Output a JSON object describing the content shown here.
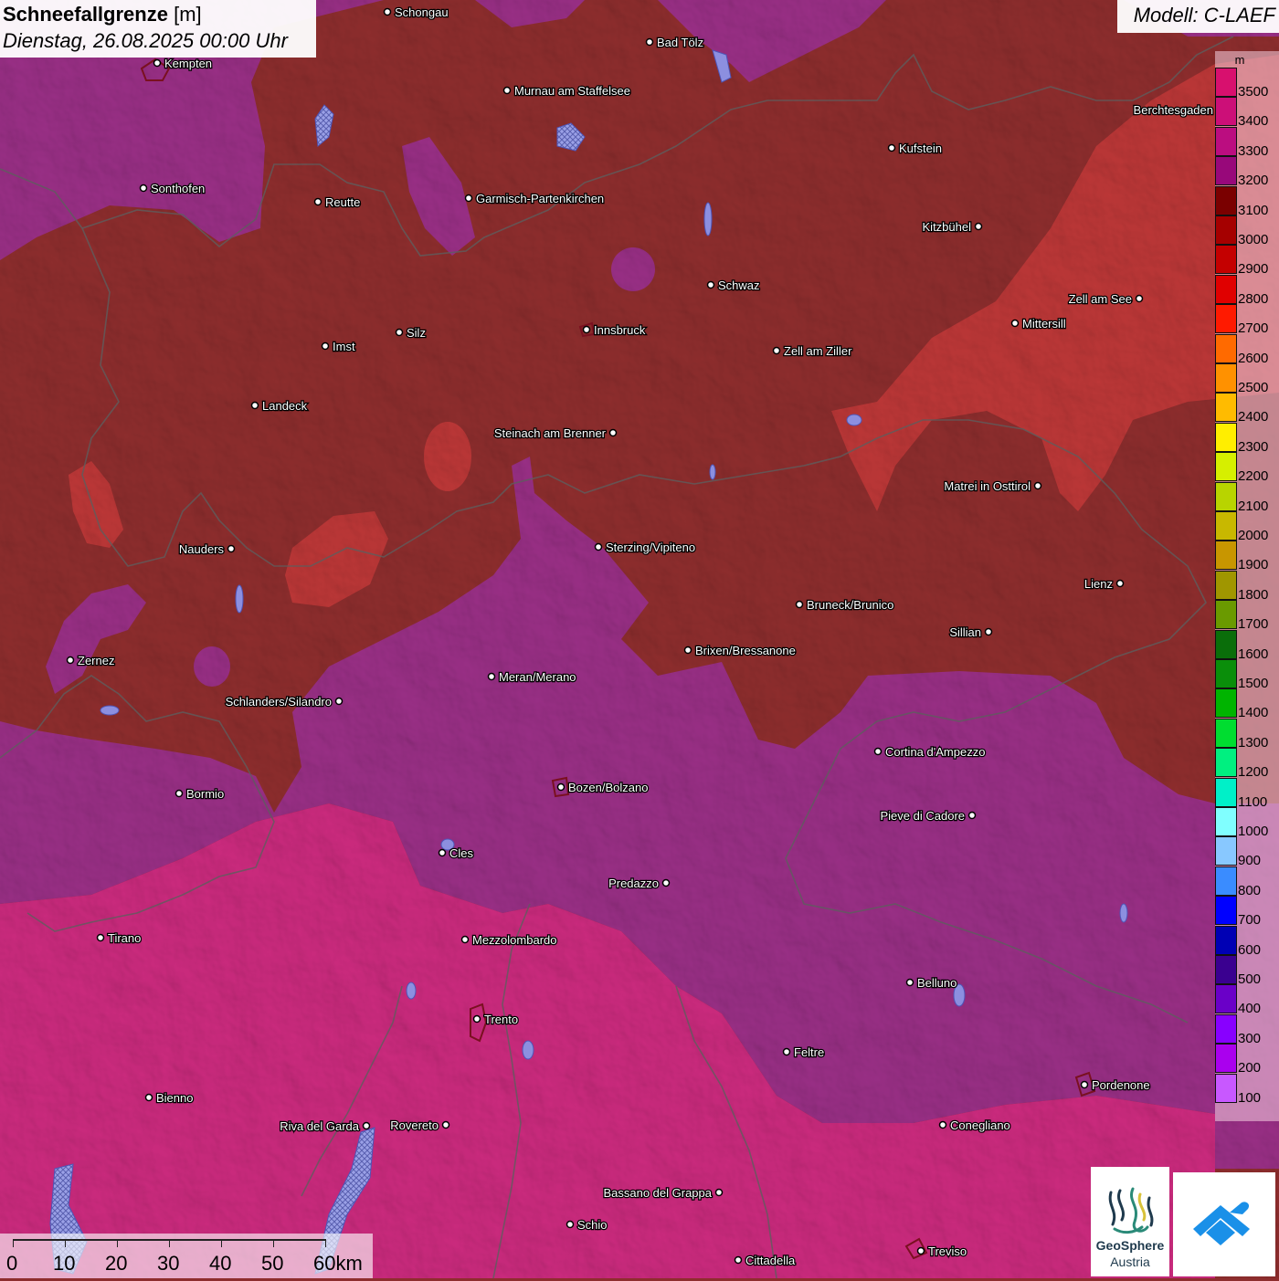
{
  "title": {
    "main": "Schneefallgrenze",
    "unit": "[m]",
    "date": "Dienstag, 26.08.2025 00:00 Uhr"
  },
  "model": "Modell: C-LAEF",
  "legend": {
    "unit": "m",
    "items": [
      {
        "label": "3500",
        "color": "#d8106e"
      },
      {
        "label": "3400",
        "color": "#cc0f78"
      },
      {
        "label": "3300",
        "color": "#bb0d80"
      },
      {
        "label": "3200",
        "color": "#98087a"
      },
      {
        "label": "3100",
        "color": "#7a0000"
      },
      {
        "label": "3000",
        "color": "#a50000"
      },
      {
        "label": "2900",
        "color": "#c40000"
      },
      {
        "label": "2800",
        "color": "#e00000"
      },
      {
        "label": "2700",
        "color": "#ff1a00"
      },
      {
        "label": "2600",
        "color": "#ff6a00"
      },
      {
        "label": "2500",
        "color": "#ff9100"
      },
      {
        "label": "2400",
        "color": "#ffbb00"
      },
      {
        "label": "2300",
        "color": "#ffee00"
      },
      {
        "label": "2200",
        "color": "#d6ef00"
      },
      {
        "label": "2100",
        "color": "#b8d400"
      },
      {
        "label": "2000",
        "color": "#c8b800"
      },
      {
        "label": "1900",
        "color": "#c89600"
      },
      {
        "label": "1800",
        "color": "#a09600"
      },
      {
        "label": "1700",
        "color": "#6a9a00"
      },
      {
        "label": "1600",
        "color": "#0a6e0a"
      },
      {
        "label": "1500",
        "color": "#0a8e0a"
      },
      {
        "label": "1400",
        "color": "#00b400"
      },
      {
        "label": "1300",
        "color": "#00dd30"
      },
      {
        "label": "1200",
        "color": "#00f080"
      },
      {
        "label": "1100",
        "color": "#00f0c8"
      },
      {
        "label": "1000",
        "color": "#80ffff"
      },
      {
        "label": "900",
        "color": "#88c8ff"
      },
      {
        "label": "800",
        "color": "#3a8cff"
      },
      {
        "label": "700",
        "color": "#0000ff"
      },
      {
        "label": "600",
        "color": "#0000b4"
      },
      {
        "label": "500",
        "color": "#3a0090"
      },
      {
        "label": "400",
        "color": "#6a00c8"
      },
      {
        "label": "300",
        "color": "#8800ff"
      },
      {
        "label": "200",
        "color": "#aa00ee"
      },
      {
        "label": "100",
        "color": "#c858ff"
      }
    ]
  },
  "scale": {
    "labels": [
      "0",
      "10",
      "20",
      "30",
      "40",
      "50",
      "60km"
    ]
  },
  "logos": {
    "geosphere_line1": "GeoSphere",
    "geosphere_line2": "Austria",
    "geosphere_icon": "geosphere-logo-icon",
    "second_icon": "mountain-arrow-logo-icon"
  },
  "cities": [
    {
      "name": "Schongau"
    },
    {
      "name": "Bad Tölz"
    },
    {
      "name": "Kempten"
    },
    {
      "name": "Murnau am Staffelsee"
    },
    {
      "name": "Berchtesgaden"
    },
    {
      "name": "Kufstein"
    },
    {
      "name": "Sonthofen"
    },
    {
      "name": "Reutte"
    },
    {
      "name": "Garmisch-Partenkirchen"
    },
    {
      "name": "Kitzbühel"
    },
    {
      "name": "Schwaz"
    },
    {
      "name": "Zell am See"
    },
    {
      "name": "Mittersill"
    },
    {
      "name": "Innsbruck"
    },
    {
      "name": "Imst"
    },
    {
      "name": "Silz"
    },
    {
      "name": "Zell am Ziller"
    },
    {
      "name": "Landeck"
    },
    {
      "name": "Steinach am Brenner"
    },
    {
      "name": "Matrei in Osttirol"
    },
    {
      "name": "Nauders"
    },
    {
      "name": "Sterzing/Vipiteno"
    },
    {
      "name": "Lienz"
    },
    {
      "name": "Bruneck/Brunico"
    },
    {
      "name": "Sillian"
    },
    {
      "name": "Brixen/Bressanone"
    },
    {
      "name": "Zernez"
    },
    {
      "name": "Meran/Merano"
    },
    {
      "name": "Schlanders/Silandro"
    },
    {
      "name": "Cortina d'Ampezzo"
    },
    {
      "name": "Bozen/Bolzano"
    },
    {
      "name": "Bormio"
    },
    {
      "name": "Pieve di Cadore"
    },
    {
      "name": "Cles"
    },
    {
      "name": "Predazzo"
    },
    {
      "name": "Tirano"
    },
    {
      "name": "Mezzolombardo"
    },
    {
      "name": "Belluno"
    },
    {
      "name": "Trento"
    },
    {
      "name": "Feltre"
    },
    {
      "name": "Pordenone"
    },
    {
      "name": "Bienno"
    },
    {
      "name": "Riva del Garda"
    },
    {
      "name": "Rovereto"
    },
    {
      "name": "Conegliano"
    },
    {
      "name": "Bassano del Grappa"
    },
    {
      "name": "Schio"
    },
    {
      "name": "Treviso"
    },
    {
      "name": "Cittadella"
    }
  ]
}
